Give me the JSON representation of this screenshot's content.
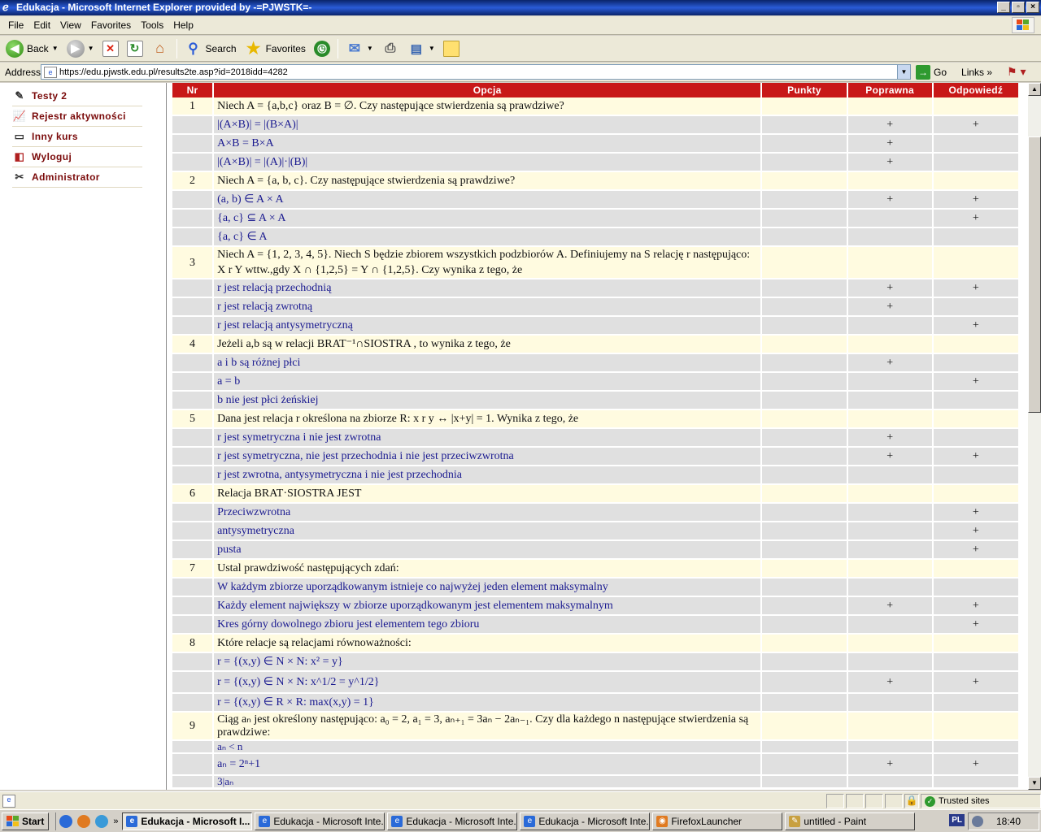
{
  "window": {
    "title": "Edukacja - Microsoft Internet Explorer provided by -=PJWSTK=-",
    "controls": [
      "_",
      "▫",
      "×"
    ]
  },
  "menu": [
    "File",
    "Edit",
    "View",
    "Favorites",
    "Tools",
    "Help"
  ],
  "toolbar": {
    "back": "Back",
    "search": "Search",
    "favorites": "Favorites"
  },
  "address": {
    "label": "Address",
    "url": "https://edu.pjwstk.edu.pl/results2te.asp?id=2018idd=4282",
    "go": "Go",
    "links": "Links"
  },
  "nav": [
    {
      "label": "Testy 2",
      "icon": "tests-icon"
    },
    {
      "label": "Rejestr aktywności",
      "icon": "chart-icon"
    },
    {
      "label": "Inny kurs",
      "icon": "monitor-icon"
    },
    {
      "label": "Wyloguj",
      "icon": "logout-icon"
    },
    {
      "label": "Administrator",
      "icon": "tools-icon"
    }
  ],
  "table": {
    "headers": [
      "Nr",
      "Opcja",
      "Punkty",
      "Poprawna",
      "Odpowiedź"
    ],
    "rows": [
      {
        "kind": "q",
        "nr": "1",
        "text": "Niech A = {a,b,c}  oraz  B = ∅. Czy następujące stwierdzenia są prawdziwe?"
      },
      {
        "kind": "a",
        "text": "|(A×B)| = |(B×A)|",
        "poprawna": "+",
        "odpowiedz": "+"
      },
      {
        "kind": "a",
        "text": "A×B = B×A",
        "poprawna": "+",
        "odpowiedz": ""
      },
      {
        "kind": "a",
        "text": "|(A×B)| = |(A)|·|(B)|",
        "poprawna": "+",
        "odpowiedz": ""
      },
      {
        "kind": "q",
        "nr": "2",
        "text": "Niech A = {a, b, c}. Czy następujące stwierdzenia są prawdziwe?"
      },
      {
        "kind": "a",
        "text": "(a, b) ∈ A × A",
        "poprawna": "+",
        "odpowiedz": "+"
      },
      {
        "kind": "a",
        "text": "{a, c}  ⊆  A × A",
        "poprawna": "",
        "odpowiedz": "+"
      },
      {
        "kind": "a",
        "text": "{a, c} ∈ A",
        "poprawna": "",
        "odpowiedz": ""
      },
      {
        "kind": "q",
        "tall": true,
        "nr": "3",
        "text": "Niech A = {1, 2, 3, 4, 5}. Niech S będzie zbiorem wszystkich podzbiorów A. Definiujemy na S relację r następująco: X r Y wttw.,gdy X ∩ {1,2,5} = Y ∩ {1,2,5}. Czy wynika z tego, że"
      },
      {
        "kind": "a",
        "text": "r jest relacją przechodnią",
        "poprawna": "+",
        "odpowiedz": "+"
      },
      {
        "kind": "a",
        "text": "r jest relacją zwrotną",
        "poprawna": "+",
        "odpowiedz": ""
      },
      {
        "kind": "a",
        "text": "r jest relacją antysymetryczną",
        "poprawna": "",
        "odpowiedz": "+"
      },
      {
        "kind": "q",
        "nr": "4",
        "text": "Jeżeli a,b są w relacji  BRAT⁻¹∩SIOSTRA , to wynika z tego, że"
      },
      {
        "kind": "a",
        "text": "a i b  są różnej płci",
        "poprawna": "+",
        "odpowiedz": ""
      },
      {
        "kind": "a",
        "text": "a = b",
        "poprawna": "",
        "odpowiedz": "+"
      },
      {
        "kind": "a",
        "text": "b nie jest płci żeńskiej",
        "poprawna": "",
        "odpowiedz": ""
      },
      {
        "kind": "q",
        "nr": "5",
        "text": "Dana jest relacja r określona na zbiorze  R: x  r  y ↔ |x+y| = 1. Wynika z tego, że"
      },
      {
        "kind": "a",
        "text": "r jest symetryczna i nie jest zwrotna",
        "poprawna": "+",
        "odpowiedz": ""
      },
      {
        "kind": "a",
        "text": "r jest symetryczna, nie jest przechodnia i nie jest przeciwzwrotna",
        "poprawna": "+",
        "odpowiedz": "+"
      },
      {
        "kind": "a",
        "text": "r jest zwrotna, antysymetryczna i nie jest przechodnia",
        "poprawna": "",
        "odpowiedz": ""
      },
      {
        "kind": "q",
        "nr": "6",
        "text": "Relacja  BRAT·SIOSTRA JEST"
      },
      {
        "kind": "a",
        "text": "Przeciwzwrotna",
        "poprawna": "",
        "odpowiedz": "+"
      },
      {
        "kind": "a",
        "text": "antysymetryczna",
        "poprawna": "",
        "odpowiedz": "+"
      },
      {
        "kind": "a",
        "text": "pusta",
        "poprawna": "",
        "odpowiedz": "+"
      },
      {
        "kind": "q",
        "nr": "7",
        "text": "Ustal prawdziwość następujących zdań:"
      },
      {
        "kind": "a",
        "text": "W każdym zbiorze uporządkowanym istnieje co najwyżej jeden element maksymalny",
        "poprawna": "",
        "odpowiedz": ""
      },
      {
        "kind": "a",
        "text": "Każdy element największy w zbiorze uporządkowanym jest elementem maksymalnym",
        "poprawna": "+",
        "odpowiedz": "+"
      },
      {
        "kind": "a",
        "text": "Kres górny dowolnego zbioru jest elementem tego zbioru",
        "poprawna": "",
        "odpowiedz": "+"
      },
      {
        "kind": "q",
        "nr": "8",
        "text": "Które relacje są relacjami równoważności:"
      },
      {
        "kind": "a",
        "text": "r = {(x,y) ∈ N × N:  x² = y}",
        "poprawna": "",
        "odpowiedz": ""
      },
      {
        "kind": "a",
        "mid": true,
        "text": "r = {(x,y) ∈ N × N:  x^1/2 = y^1/2}",
        "poprawna": "+",
        "odpowiedz": "+"
      },
      {
        "kind": "a",
        "text": "r = {(x,y) ∈ R × R:  max(x,y) = 1}",
        "poprawna": "",
        "odpowiedz": ""
      },
      {
        "kind": "q",
        "nr": "9",
        "text": "Ciąg aₙ jest określony następująco: a₀ = 2,  a₁ = 3,  aₙ₊₁ = 3aₙ − 2aₙ₋₁. Czy dla każdego n następujące stwierdzenia są prawdziwe:"
      },
      {
        "kind": "a",
        "short": true,
        "text": "aₙ < n",
        "poprawna": "",
        "odpowiedz": ""
      },
      {
        "kind": "a",
        "mid": true,
        "text": "aₙ = 2ⁿ+1",
        "poprawna": "+",
        "odpowiedz": "+"
      },
      {
        "kind": "a",
        "short": true,
        "text": "3|aₙ",
        "poprawna": "",
        "odpowiedz": ""
      }
    ]
  },
  "status": {
    "zone": "Trusted sites"
  },
  "taskbar": {
    "start": "Start",
    "tasks": [
      {
        "label": "Edukacja - Microsoft I...",
        "active": true
      },
      {
        "label": "Edukacja - Microsoft Inte...",
        "active": false
      },
      {
        "label": "Edukacja - Microsoft Inte...",
        "active": false
      },
      {
        "label": "Edukacja - Microsoft Inte...",
        "active": false
      },
      {
        "label": "FirefoxLauncher",
        "active": false
      },
      {
        "label": "untitled - Paint",
        "active": false
      }
    ],
    "lang": "PL",
    "clock": "18:40"
  }
}
